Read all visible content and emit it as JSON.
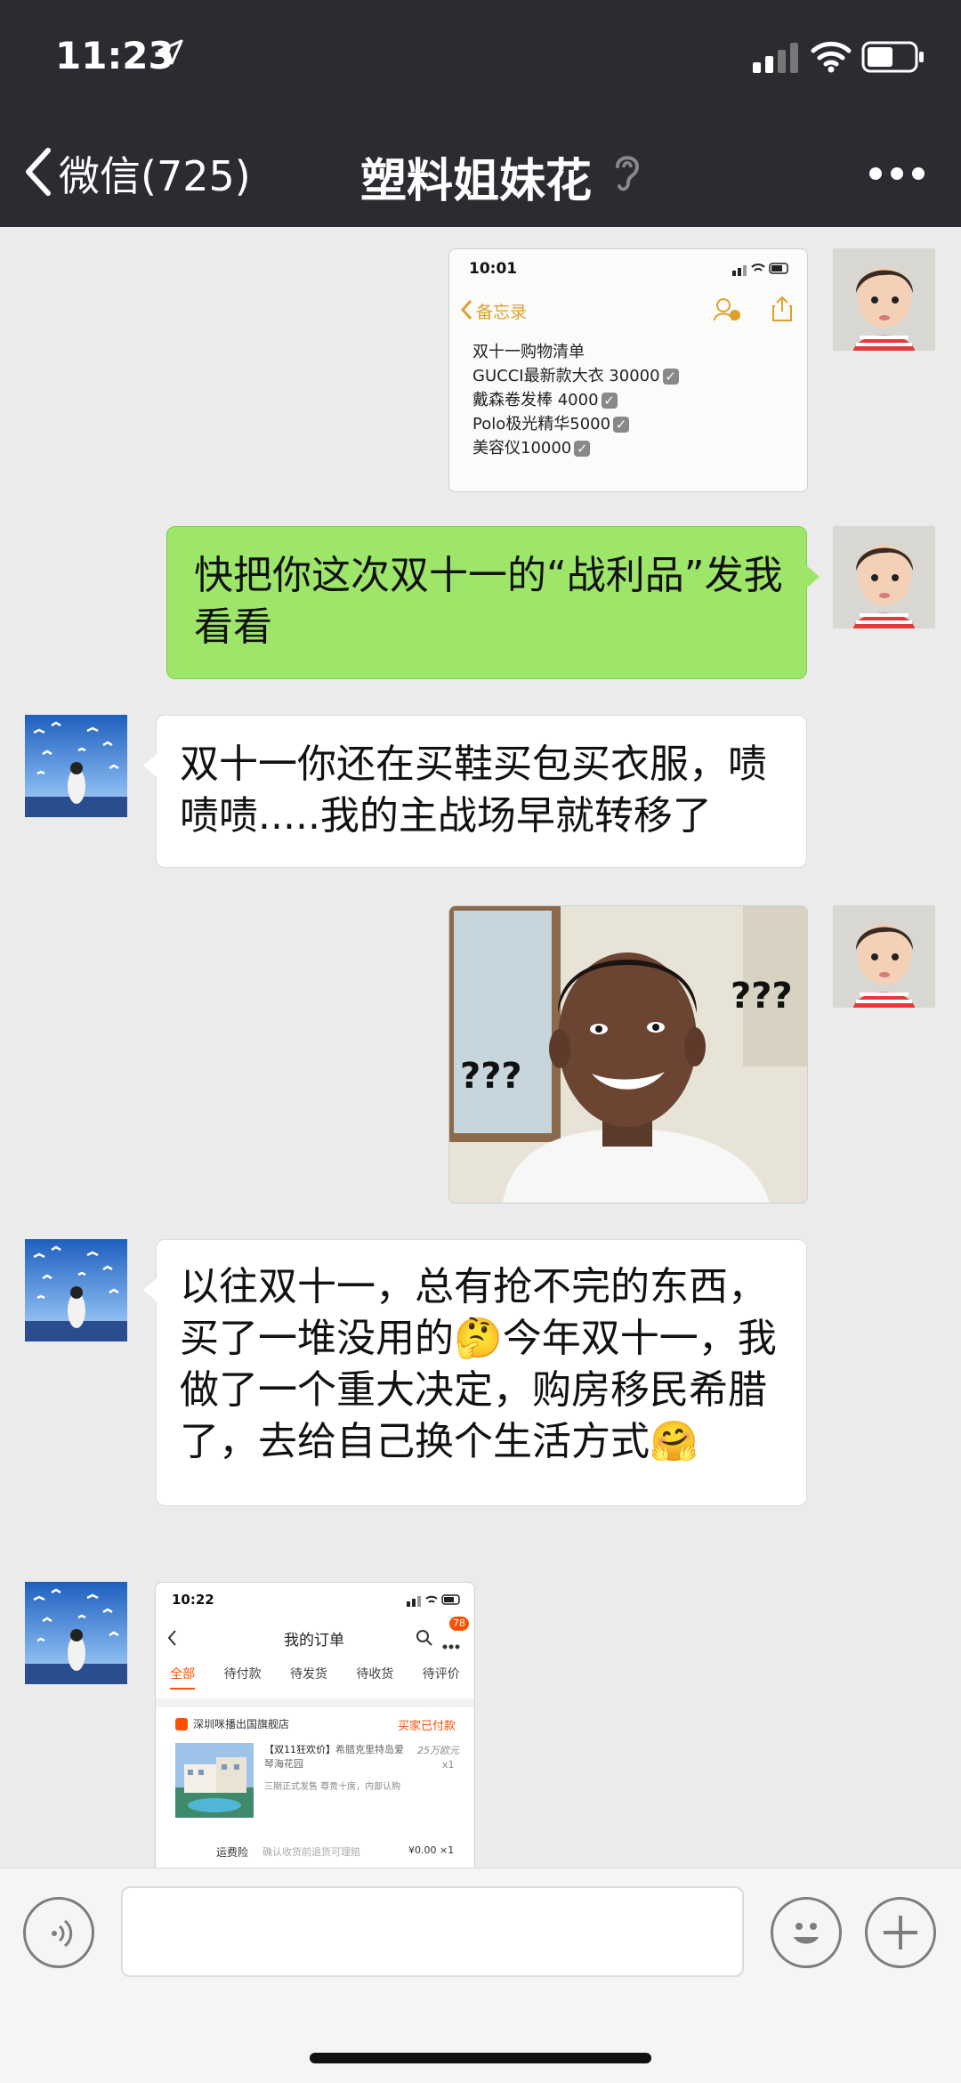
{
  "status": {
    "time": "11:23"
  },
  "nav": {
    "back_label": "微信(725)",
    "title": "塑料姐妹花"
  },
  "notes_shot": {
    "time": "10:01",
    "app_back": "备忘录",
    "lines": [
      "双十一购物清单",
      "GUCCI最新款大衣 30000",
      "戴森卷发棒 4000",
      "Polo极光精华5000",
      "美容仪10000"
    ]
  },
  "messages": {
    "m1": "快把你这次双十一的“战利品”发我看看",
    "m2": "双十一你还在买鞋买包买衣服，啧啧啧.....我的主战场早就转移了",
    "meme_text": "???",
    "m3": "以往双十一，总有抢不完的东西，买了一堆没用的🤔今年双十一，我做了一个重大决定，购房移民希腊了，去给自己换个生活方式🤗"
  },
  "order_shot": {
    "time": "10:22",
    "title": "我的订单",
    "badge": "78",
    "tabs": [
      "全部",
      "待付款",
      "待发货",
      "待收货",
      "待评价"
    ],
    "shop": "深圳咪播出国旗舰店",
    "status": "买家已付款",
    "item_title_a": "【双11狂欢价】",
    "item_title_b": "希腊克里特岛爱琴海花园",
    "item_desc": "三期正式发售 尊贵十席，内部认购",
    "price": "25万欧元",
    "qty": "x1",
    "insurance_label": "运费险",
    "insurance_desc": "确认收货前退货可理赔",
    "insurance_price": "¥0.00 ×1"
  },
  "colors": {
    "nav_bg": "#2b2c32",
    "chat_bg": "#ebebeb",
    "green_bubble": "#9ee66a",
    "order_accent": "#ff5000"
  }
}
